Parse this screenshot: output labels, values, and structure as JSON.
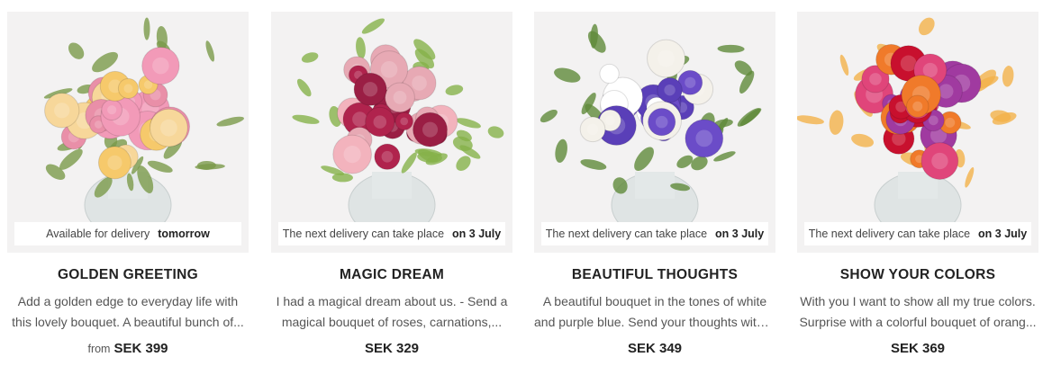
{
  "products": [
    {
      "name": "GOLDEN GREETING",
      "delivery_text": "Available for delivery",
      "delivery_date": "tomorrow",
      "description_line1": "Add a golden edge to everyday life with",
      "description_line2": "this lovely bouquet. A beautiful bunch of...",
      "price_prefix": "from",
      "price": "SEK 399",
      "image": "golden-greeting-bouquet-image",
      "colors": [
        "#f6c96b",
        "#f29ab8",
        "#f7d79a",
        "#e98fa8",
        "#7a9a4a"
      ]
    },
    {
      "name": "MAGIC DREAM",
      "delivery_text": "The next delivery can take place",
      "delivery_date": "on 3 July",
      "description_line1": "I had a magical dream about us. - Send a",
      "description_line2": "magical bouquet of roses, carnations,...",
      "price_prefix": "",
      "price": "SEK 329",
      "image": "magic-dream-bouquet-image",
      "colors": [
        "#f3b3bd",
        "#b0234d",
        "#9a1e44",
        "#e7a9b4",
        "#86b24a"
      ]
    },
    {
      "name": "BEAUTIFUL THOUGHTS",
      "delivery_text": "The next delivery can take place",
      "delivery_date": "on 3 July",
      "description_line1": "A beautiful bouquet in the tones of white",
      "description_line2": "and purple blue. Send your thoughts with ...",
      "price_prefix": "",
      "price": "SEK 349",
      "image": "beautiful-thoughts-bouquet-image",
      "colors": [
        "#ffffff",
        "#f4f1ea",
        "#5a3fb8",
        "#6b4cc8",
        "#5f8a3a"
      ]
    },
    {
      "name": "SHOW YOUR COLORS",
      "delivery_text": "The next delivery can take place",
      "delivery_date": "on 3 July",
      "description_line1": "With you I want to show all my true colors.",
      "description_line2": "Surprise with a colorful bouquet of orang...",
      "price_prefix": "",
      "price": "SEK 369",
      "image": "show-your-colors-bouquet-image",
      "colors": [
        "#f07a2a",
        "#e0457a",
        "#a03aa0",
        "#c8102e",
        "#f3b24a"
      ]
    }
  ]
}
